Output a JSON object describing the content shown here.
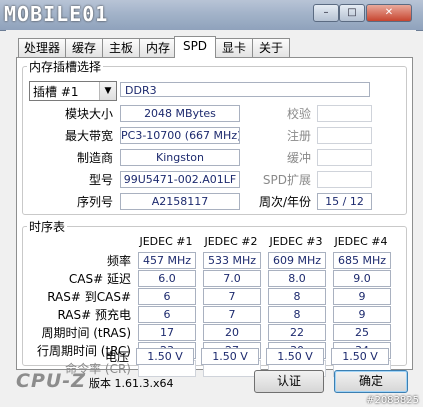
{
  "window": {
    "watermark_brand": "MOBILE01",
    "controls": {
      "minimize": "–",
      "maximize": "□",
      "close": "✕"
    }
  },
  "tabs": [
    "处理器",
    "缓存",
    "主板",
    "内存",
    "SPD",
    "显卡",
    "关于"
  ],
  "active_tab": "SPD",
  "slot_group": {
    "title": "内存插槽选择",
    "slot": "插槽 #1",
    "memory_type": "DDR3",
    "rows": [
      {
        "label": "模块大小",
        "value": "2048 MBytes",
        "right_label": "校验",
        "right_value": ""
      },
      {
        "label": "最大带宽",
        "value": "PC3-10700 (667 MHz)",
        "right_label": "注册",
        "right_value": ""
      },
      {
        "label": "制造商",
        "value": "Kingston",
        "right_label": "缓冲",
        "right_value": ""
      },
      {
        "label": "型号",
        "value": "99U5471-002.A01LF",
        "right_label": "SPD扩展",
        "right_value": ""
      },
      {
        "label": "序列号",
        "value": "A2158117",
        "right_label": "周次/年份",
        "right_value": "15 / 12"
      }
    ]
  },
  "timing_group": {
    "title": "时序表",
    "columns": [
      "JEDEC #1",
      "JEDEC #2",
      "JEDEC #3",
      "JEDEC #4"
    ],
    "rows": [
      {
        "label": "频率",
        "values": [
          "457 MHz",
          "533 MHz",
          "609 MHz",
          "685 MHz"
        ]
      },
      {
        "label": "CAS# 延迟",
        "values": [
          "6.0",
          "7.0",
          "8.0",
          "9.0"
        ]
      },
      {
        "label": "RAS# 到CAS#",
        "values": [
          "6",
          "7",
          "8",
          "9"
        ]
      },
      {
        "label": "RAS# 预充电",
        "values": [
          "6",
          "7",
          "8",
          "9"
        ]
      },
      {
        "label": "周期时间 (tRAS)",
        "values": [
          "17",
          "20",
          "22",
          "25"
        ]
      },
      {
        "label": "行周期时间 (tRC)",
        "values": [
          "23",
          "27",
          "30",
          "34"
        ]
      },
      {
        "label": "命令率 (CR)",
        "values": [
          "",
          "",
          "",
          ""
        ]
      },
      {
        "label": "电压",
        "values": [
          "1.50 V",
          "1.50 V",
          "1.50 V",
          "1.50 V"
        ]
      }
    ]
  },
  "footer": {
    "logo": "CPU-Z",
    "version": "版本 1.61.3.x64",
    "validate_button": "认证",
    "ok_button": "确定",
    "watermark": "#2083825"
  }
}
